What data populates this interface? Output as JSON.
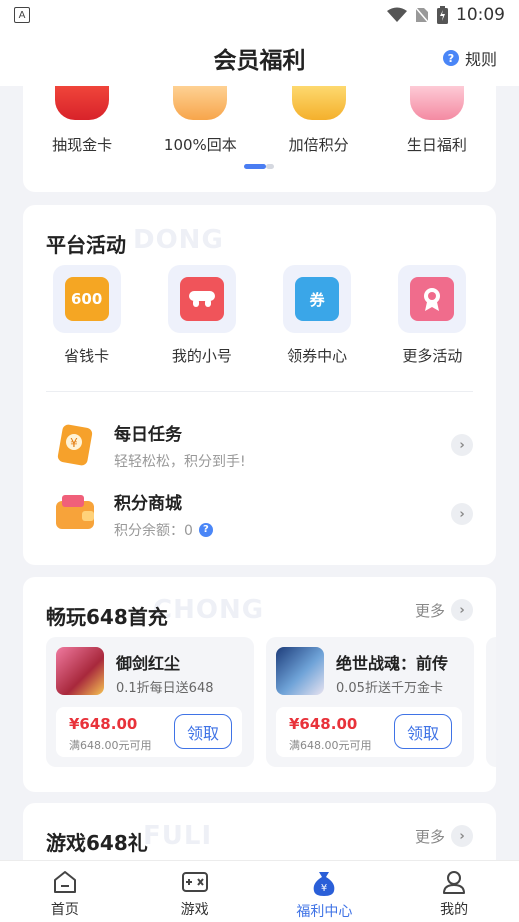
{
  "status_bar": {
    "time": "10:09",
    "left_icon": "A"
  },
  "header": {
    "title": "会员福利",
    "rules_label": "规则"
  },
  "perks": [
    {
      "label": "抽现金卡",
      "icon": "red-packet-icon"
    },
    {
      "label": "100%回本",
      "icon": "diamond-icon"
    },
    {
      "label": "加倍积分",
      "icon": "coin-icon"
    },
    {
      "label": "生日福利",
      "icon": "cake-icon"
    }
  ],
  "platform": {
    "title": "平台活动",
    "watermark": "DONG",
    "activities": [
      {
        "label": "省钱卡",
        "icon_text": "600",
        "color": "#f5a623"
      },
      {
        "label": "我的小号",
        "icon_text": "",
        "color": "#f0545a"
      },
      {
        "label": "领券中心",
        "icon_text": "券",
        "color": "#3aa6e8"
      },
      {
        "label": "更多活动",
        "icon_text": "",
        "color": "#f06c8c"
      }
    ],
    "tasks": [
      {
        "title": "每日任务",
        "sub": "轻轻松松，积分到手!"
      },
      {
        "title": "积分商城",
        "sub": "积分余额：0"
      }
    ]
  },
  "recharge": {
    "title": "畅玩648首充",
    "watermark": "CHONG",
    "more_label": "更多",
    "games": [
      {
        "name": "御剑红尘",
        "desc": "0.1折每日送648",
        "price": "¥648.00",
        "cond": "满648.00元可用",
        "claim": "领取"
      },
      {
        "name": "绝世战魂：前传",
        "desc": "0.05折送千万金卡",
        "price": "¥648.00",
        "cond": "满648.00元可用",
        "claim": "领取"
      }
    ]
  },
  "gift": {
    "title": "游戏648礼",
    "watermark": "FULI",
    "more_label": "更多"
  },
  "tabs": [
    {
      "label": "首页"
    },
    {
      "label": "游戏"
    },
    {
      "label": "福利中心"
    },
    {
      "label": "我的"
    }
  ],
  "colors": {
    "accent": "#3f73e6",
    "price_red": "#e8323a",
    "background": "#f2f3f7"
  }
}
